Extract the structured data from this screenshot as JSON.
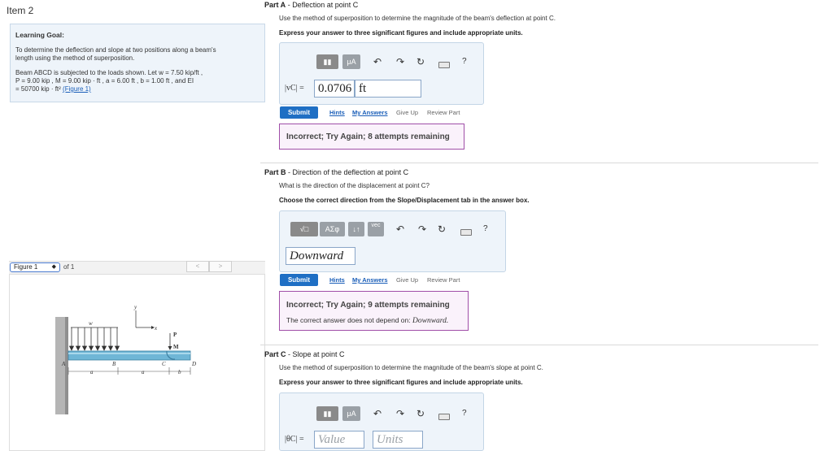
{
  "item": {
    "title": "Item 2"
  },
  "goal": {
    "title": "Learning Goal:",
    "description": "To determine the deflection and slope at two positions along a beam's length using the method of superposition.",
    "values_line1": "Beam ABCD is subjected to the loads shown. Let w = 7.50 kip/ft ,",
    "values_line2": "P = 9.00 kip , M = 9.00 kip · ft , a = 6.00 ft , b = 1.00 ft , and EI",
    "values_line3": "= 50700 kip · ft²",
    "figure_link": "(Figure 1)"
  },
  "figure": {
    "selector": "Figure 1",
    "of": "of 1",
    "prev": "<",
    "next": ">",
    "labels": {
      "y": "y",
      "x": "x",
      "w": "w",
      "P": "P",
      "M": "M",
      "A": "A",
      "B": "B",
      "C": "C",
      "D": "D",
      "a1": "a",
      "a2": "a",
      "b": "b"
    }
  },
  "parts": {
    "a": {
      "label": "Part A",
      "title": "Deflection at point C",
      "instruction": "Use the method of superposition to determine the magnitude of the beam's deflection at point C.",
      "directive": "Express your answer to three significant figures and include appropriate units.",
      "var_label": "|vC| =",
      "value": "0.0706",
      "units": "ft",
      "toolbar": {
        "templates": "▮▮",
        "mu": "μA",
        "help": "?"
      },
      "submit": "Submit",
      "hints": "Hints",
      "my_answers": "My Answers",
      "give_up": "Give Up",
      "review": "Review Part",
      "feedback": "Incorrect; Try Again; 8 attempts remaining"
    },
    "b": {
      "label": "Part B",
      "title": "Direction of the deflection at point C",
      "question": "What is the direction of the displacement at point C?",
      "directive": "Choose the correct direction from the Slope/Displacement tab in the answer box.",
      "toolbar": {
        "sqrt": "√□",
        "greek": "ΑΣφ",
        "arrows": "↓↑",
        "vec": "vec",
        "help": "?"
      },
      "answer": "Downward",
      "submit": "Submit",
      "hints": "Hints",
      "my_answers": "My Answers",
      "give_up": "Give Up",
      "review": "Review Part",
      "feedback": "Incorrect; Try Again; 9 attempts remaining",
      "note_prefix": "The correct answer does not depend on:",
      "note_value": "Downward."
    },
    "c": {
      "label": "Part C",
      "title": "Slope at point C",
      "instruction": "Use the method of superposition to determine the magnitude of the beam's slope at point C.",
      "directive": "Express your answer to three significant figures and include appropriate units.",
      "var_label": "|θC| =",
      "value_placeholder": "Value",
      "units_placeholder": "Units",
      "toolbar": {
        "templates": "▮▮",
        "mu": "μA",
        "help": "?"
      }
    }
  },
  "colors": {
    "accent": "#1f6fc4",
    "answer_box": "#eef4fa",
    "feedback_border": "#a04fa8",
    "feedback_bg": "#faf2fb"
  }
}
